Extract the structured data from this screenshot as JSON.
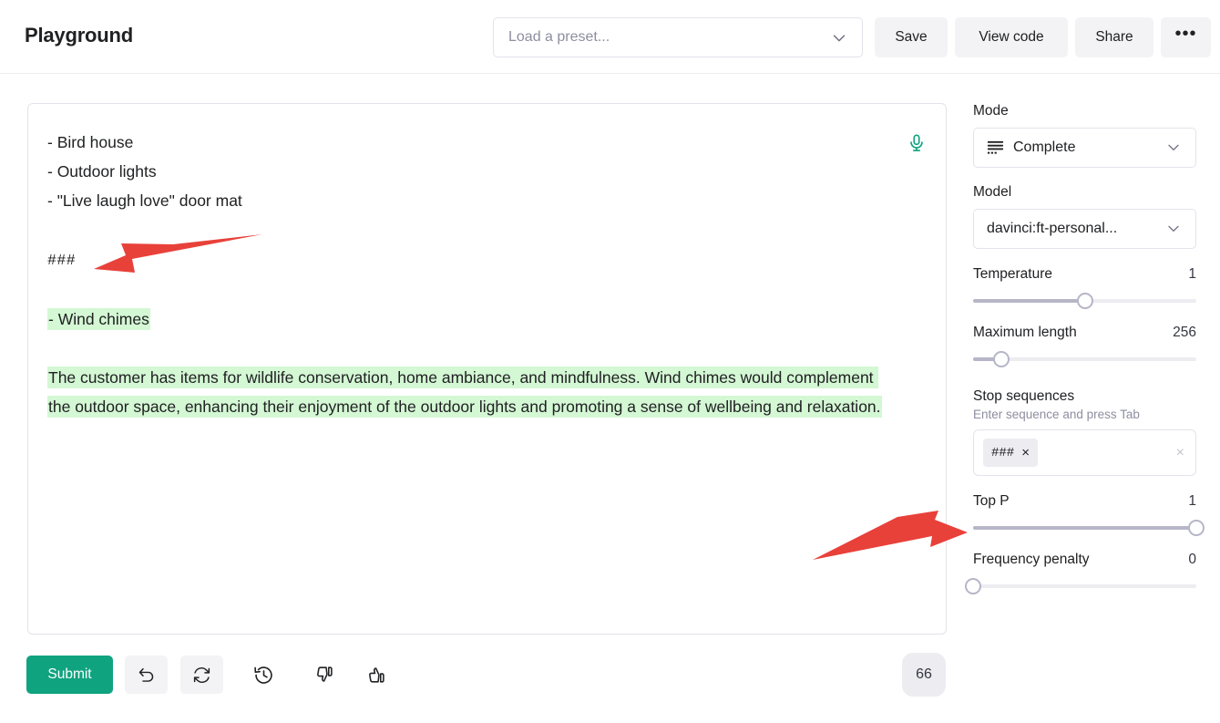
{
  "header": {
    "title": "Playground",
    "preset": {
      "placeholder": "Load a preset...",
      "value": ""
    },
    "buttons": {
      "save": "Save",
      "view_code": "View code",
      "share": "Share",
      "more": "•••"
    }
  },
  "editor": {
    "lines": [
      {
        "text": "- Bird house",
        "highlight": false,
        "mono": false
      },
      {
        "text": "- Outdoor lights",
        "highlight": false,
        "mono": false
      },
      {
        "text": "- \"Live laugh love\" door mat",
        "highlight": false,
        "mono": false
      },
      {
        "text": "",
        "highlight": false,
        "mono": false
      },
      {
        "text": "###",
        "highlight": false,
        "mono": true
      },
      {
        "text": "",
        "highlight": false,
        "mono": false
      },
      {
        "text": "- Wind chimes",
        "highlight": true,
        "mono": false
      },
      {
        "text": "",
        "highlight": false,
        "mono": false
      },
      {
        "text": "The customer has items for wildlife conservation, home ambiance, and mindfulness. Wind chimes would complement the outdoor space, enhancing their enjoyment of the outdoor lights and promoting a sense of wellbeing and relaxation.",
        "highlight": true,
        "mono": false
      }
    ],
    "mic_icon": "microphone-icon",
    "completion_highlight_color": "#d4f7d4"
  },
  "toolbar": {
    "submit_label": "Submit",
    "undo_icon": "undo-icon",
    "regenerate_icon": "regenerate-icon",
    "history_icon": "history-icon",
    "thumbs_down_icon": "thumbs-down-icon",
    "thumbs_up_icon": "thumbs-up-icon",
    "token_count": "66",
    "submit_color": "#10a37f"
  },
  "panel": {
    "mode": {
      "label": "Mode",
      "value": "Complete",
      "icon": "complete-mode-icon"
    },
    "model": {
      "label": "Model",
      "value": "davinci:ft-personal..."
    },
    "temperature": {
      "label": "Temperature",
      "value": "1",
      "percent": 50
    },
    "maximum_length": {
      "label": "Maximum length",
      "value": "256",
      "percent": 12.5
    },
    "stop_sequences": {
      "label": "Stop sequences",
      "hint": "Enter sequence and press Tab",
      "chips": [
        {
          "text": "###",
          "remove_icon": "×"
        }
      ],
      "clear_icon": "×"
    },
    "top_p": {
      "label": "Top P",
      "value": "1",
      "percent": 100
    },
    "frequency_penalty": {
      "label": "Frequency penalty",
      "value": "0",
      "percent": 0
    }
  },
  "annotations": {
    "arrow_color": "#e8413a",
    "arrow_1_target": "hash-stop-token-in-prompt",
    "arrow_2_target": "stop-sequences-field"
  }
}
